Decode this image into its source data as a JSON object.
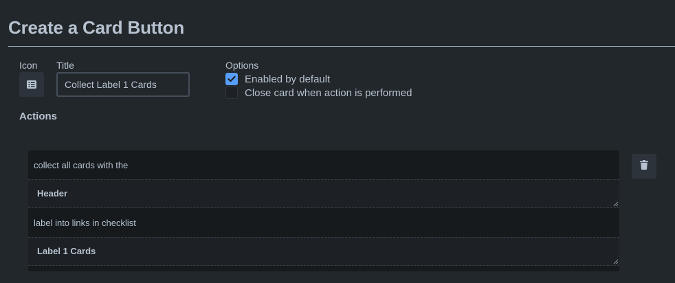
{
  "header": {
    "title": "Create a Card Button"
  },
  "form": {
    "icon_label": "Icon",
    "icon_name": "card-list-icon",
    "title_label": "Title",
    "title_value": "Collect Label 1 Cards",
    "options_label": "Options",
    "options": [
      {
        "label": "Enabled by default",
        "checked": true
      },
      {
        "label": "Close card when action is performed",
        "checked": false
      }
    ]
  },
  "actions": {
    "heading": "Actions",
    "text_1": "collect all cards with the",
    "field_1": "Header",
    "text_2": "label into links in checklist",
    "field_2": "Label 1 Cards",
    "delete_icon": "trash-icon"
  },
  "colors": {
    "background": "#22272b",
    "checkbox_checked": "#579dff",
    "text": "#b6c2cf"
  }
}
